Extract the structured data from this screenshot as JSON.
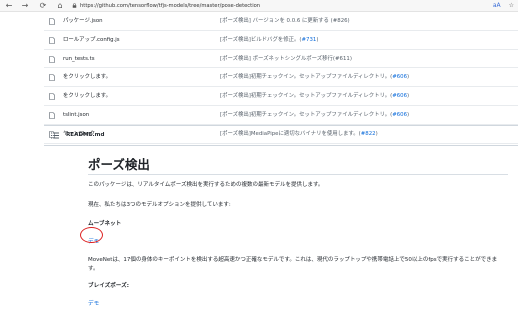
{
  "browser": {
    "url": "https://github.com/tensorflow/tfjs-models/tree/master/pose-detection",
    "reader_icon": "reader-view-icon",
    "right_icons": [
      "aA",
      "☆"
    ]
  },
  "files": [
    {
      "name": "パッケージ.json",
      "message": "[ポーズ検出] バージョンを 0.0.6 に更新する (#826)",
      "pr": ""
    },
    {
      "name": "ロールアップ.config.js",
      "message": "[ポーズ検出]ビルドバグを修正。(",
      "pr": "#731",
      "suffix": ")"
    },
    {
      "name": "run_tests.ts",
      "message": "[ポーズ検出] ポーズネットシングルポーズ移行(#611)",
      "pr": ""
    },
    {
      "name": "をクリックします。",
      "message": "[ポーズ検出]初期チェックイン。セットアップファイルディレクトリ。(",
      "pr": "#606",
      "suffix": ")"
    },
    {
      "name": "をクリックします。",
      "message": "[ポーズ検出]初期チェックイン。セットアップファイルディレクトリ。(",
      "pr": "#606",
      "suffix": ")"
    },
    {
      "name": "tslint.json",
      "message": "[ポーズ検出]初期チェックイン。セットアップファイルディレクトリ。(",
      "pr": "#606",
      "suffix": ")"
    },
    {
      "name": "ヤーンロック",
      "message": "[ポーズ検出]MediaPipeに適切なバイナリを使用します。(",
      "pr": "#822",
      "suffix": ")"
    }
  ],
  "readme": {
    "filename": "README.md",
    "title": "ポーズ検出",
    "intro": "このパッケージは、リアルタイムポーズ検出を実行するための複数の最新モデルを提供します。",
    "models_intro": "現在、私たちは3つのモデルオプションを提供しています:",
    "movenet_heading": "ムーブネット",
    "movenet_demo_link": "デモ",
    "movenet_desc": "MoveNetは、17個の身体のキーポイントを検出する超高速かつ正確なモデルです。これは、現代のラップトップや携帯電話上で50以上のfpsで実行することができま",
    "movenet_desc_2": "す。",
    "blazepose_heading": "ブレイズポーズ:",
    "blazepose_demo_link": "デモ"
  }
}
